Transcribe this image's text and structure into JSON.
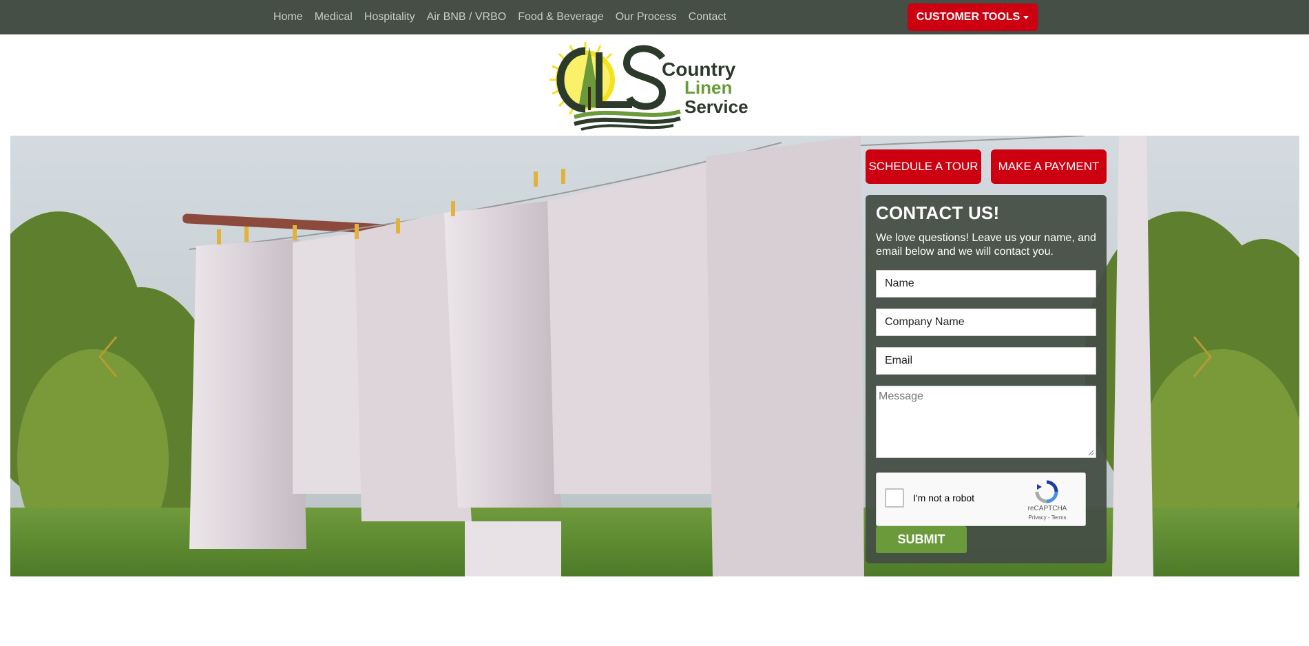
{
  "nav": {
    "items": [
      "Home",
      "Medical",
      "Hospitality",
      "Air BNB / VRBO",
      "Food & Beverage",
      "Our Process",
      "Contact"
    ],
    "customer_tools_label": "CUSTOMER TOOLS"
  },
  "logo": {
    "letters": "CLS",
    "word1": "Country",
    "word2": "Linen",
    "word3": "Service"
  },
  "hero": {
    "schedule_label": "SCHEDULE A TOUR",
    "payment_label": "MAKE A PAYMENT"
  },
  "contact": {
    "title": "CONTACT US!",
    "intro": "We love questions! Leave us your name, and email below and we will contact you.",
    "name_value": "Name",
    "company_value": "Company Name",
    "email_value": "Email",
    "message_placeholder": "Message",
    "captcha_label": "I'm not a robot",
    "captcha_brand": "reCAPTCHA",
    "captcha_links": "Privacy - Terms",
    "submit_label": "SUBMIT"
  },
  "colors": {
    "nav_bg": "#454f45",
    "accent_red": "#cc0011",
    "submit_green": "#6a9a3a",
    "panel_bg": "#454f45"
  },
  "icons": [
    "caret-down-icon",
    "chevron-left-icon",
    "chevron-right-icon",
    "recaptcha-icon",
    "resize-grip-icon"
  ]
}
